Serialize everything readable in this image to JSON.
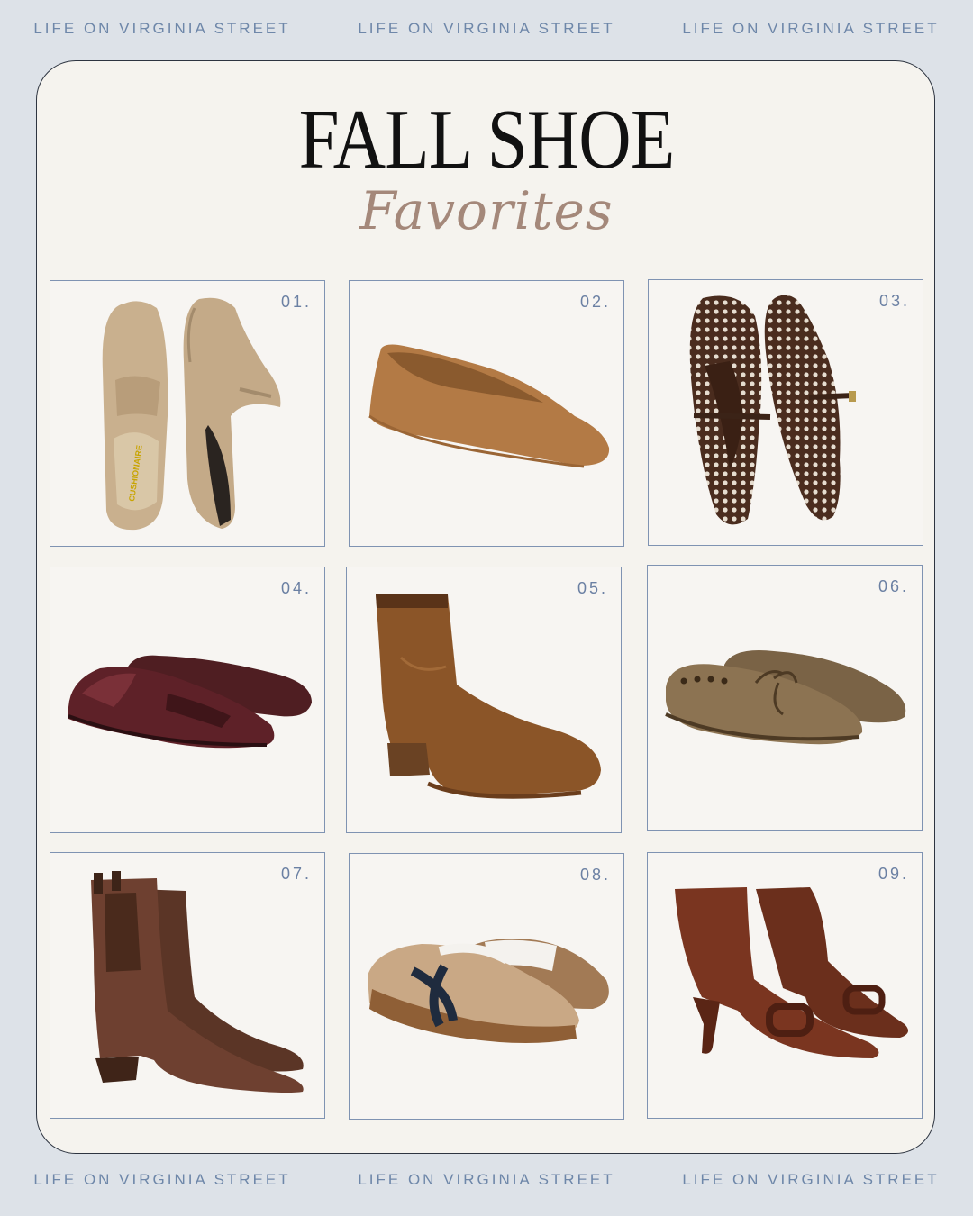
{
  "banner": {
    "top": [
      "LIFE ON VIRGINIA STREET",
      "LIFE ON VIRGINIA STREET",
      "LIFE ON VIRGINIA STREET"
    ],
    "bottom": [
      "LIFE ON VIRGINIA STREET",
      "LIFE ON VIRGINIA STREET",
      "LIFE ON VIRGINIA STREET"
    ]
  },
  "title": "FALL SHOE",
  "subtitle": "Favorites",
  "items": [
    {
      "number": "01.",
      "icon": "tan-suede-loafer-mules-icon",
      "brand_on_insole": "CUSHIONAIRE"
    },
    {
      "number": "02.",
      "icon": "camel-suede-ballet-flat-icon"
    },
    {
      "number": "03.",
      "icon": "brown-woven-mary-jane-flats-icon"
    },
    {
      "number": "04.",
      "icon": "burgundy-leather-penny-loafers-icon"
    },
    {
      "number": "05.",
      "icon": "cognac-suede-ankle-boot-icon"
    },
    {
      "number": "06.",
      "icon": "taupe-suede-driving-moccasins-icon"
    },
    {
      "number": "07.",
      "icon": "brown-leather-chelsea-boots-icon"
    },
    {
      "number": "08.",
      "icon": "tan-retro-sneakers-icon"
    },
    {
      "number": "09.",
      "icon": "rust-suede-kitten-heel-buckle-boots-icon"
    }
  ],
  "colors": {
    "background": "#dde2e8",
    "card": "#f5f3ee",
    "accent_blue": "#6e87a9",
    "script_tan": "#a4887a"
  }
}
